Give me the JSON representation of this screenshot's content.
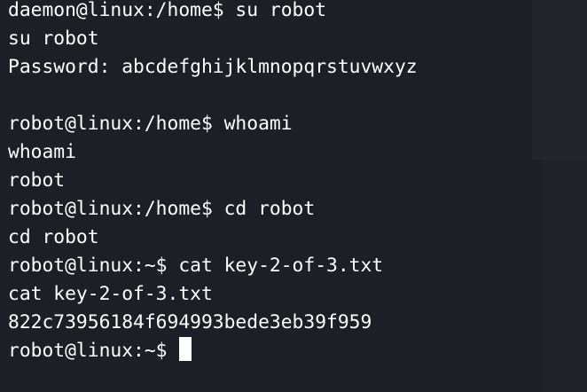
{
  "terminal": {
    "lines": [
      "daemon@linux:/home$ su robot",
      "su robot",
      "Password: abcdefghijklmnopqrstuvwxyz",
      "",
      "robot@linux:/home$ whoami",
      "whoami",
      "robot",
      "robot@linux:/home$ cd robot",
      "cd robot",
      "robot@linux:~$ cat key-2-of-3.txt",
      "cat key-2-of-3.txt",
      "822c73956184f694993bede3eb39f959"
    ],
    "prompt": "robot@linux:~$"
  },
  "colors": {
    "background": "#1c1f25",
    "text": "#ffffff",
    "cursor": "#ffffff"
  }
}
